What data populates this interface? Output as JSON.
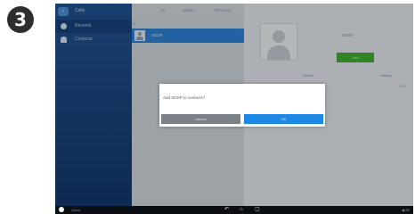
{
  "step_number": "3",
  "sidebar": {
    "back_label": "",
    "title": "Calls",
    "items": [
      {
        "label": "Recents",
        "icon": "clock-icon"
      },
      {
        "label": "Contacts",
        "icon": "person-icon"
      }
    ]
  },
  "tabs": [
    "All",
    "Webex",
    "Personal"
  ],
  "contacts_list": {
    "section_label": "A",
    "rows": [
      {
        "name": "SDDP",
        "more": "···"
      }
    ]
  },
  "detail": {
    "name": "SDDP",
    "add_button": "Add",
    "tabs": [
      "Details",
      "History"
    ],
    "number": "1001"
  },
  "dialog": {
    "message": "Add SDDP to contacts?",
    "cancel_label": "Cancel",
    "ok_label": "OK"
  },
  "status_bar": {
    "carrier": "Cisco",
    "nav": [
      "↶",
      "⌂",
      "▢"
    ],
    "right": "◂) 07"
  },
  "colors": {
    "sidebar_blue": "#1e4f8f",
    "selected_row": "#2a7fd6",
    "add_green": "#3fae2a",
    "ok_blue": "#1c89e6",
    "cancel_gray": "#7b8187"
  }
}
